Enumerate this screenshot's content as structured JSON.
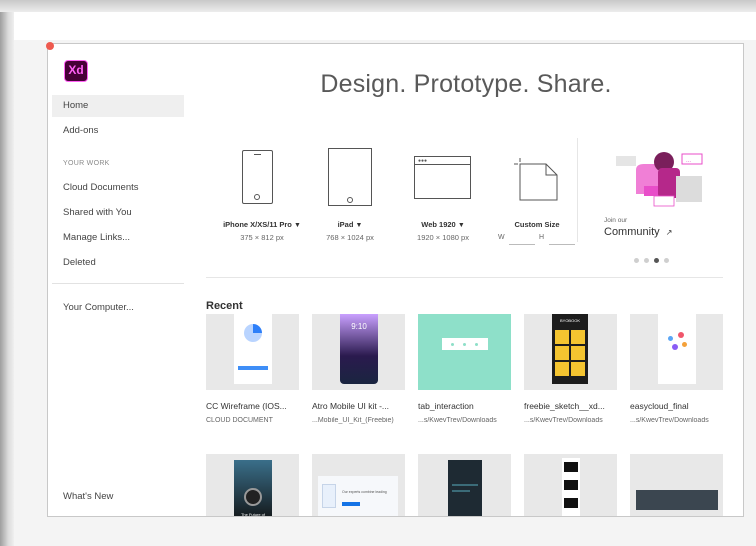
{
  "app": {
    "logo_text": "Xd",
    "headline": "Design. Prototype. Share."
  },
  "sidebar": {
    "top_items": [
      "Home",
      "Add-ons"
    ],
    "section_label": "YOUR WORK",
    "work_items": [
      "Cloud Documents",
      "Shared with You",
      "Manage Links...",
      "Deleted"
    ],
    "computer_item": "Your Computer...",
    "bottom_item": "What's New"
  },
  "presets": [
    {
      "name": "iPhone X/XS/11 Pro",
      "dims": "375 × 812 px",
      "has_chevron": true
    },
    {
      "name": "iPad",
      "dims": "768 × 1024 px",
      "has_chevron": true
    },
    {
      "name": "Web 1920",
      "dims": "1920 × 1080 px",
      "has_chevron": true
    },
    {
      "name": "Custom Size",
      "w_label": "W",
      "h_label": "H"
    }
  ],
  "community": {
    "join_text": "Join our",
    "label": "Community"
  },
  "recent": {
    "title": "Recent",
    "files": [
      {
        "name": "CC Wireframe (IOS...",
        "location": "CLOUD DOCUMENT"
      },
      {
        "name": "Atro Mobile UI kit -...",
        "location": "...Mobile_UI_Kit_(Freebie)"
      },
      {
        "name": "tab_interaction",
        "location": "...s/KwevTrev/Downloads"
      },
      {
        "name": "freebie_sketch__xd...",
        "location": "...s/KwevTrev/Downloads"
      },
      {
        "name": "easycloud_final",
        "location": "...s/KwevTrev/Downloads"
      }
    ],
    "thumb_texts": {
      "atro_time": "9:10",
      "freebie_heading": "BYOBOOK",
      "bokeh_caption": "The Future of",
      "web_heading": "Our experts combine leading"
    }
  },
  "colors": {
    "accent": "#1473e6",
    "xd_bg": "#470137",
    "xd_pink": "#ff61f6",
    "community_pink": "#e84ec9",
    "mint": "#8ee0c9",
    "yellow": "#f4c430"
  }
}
